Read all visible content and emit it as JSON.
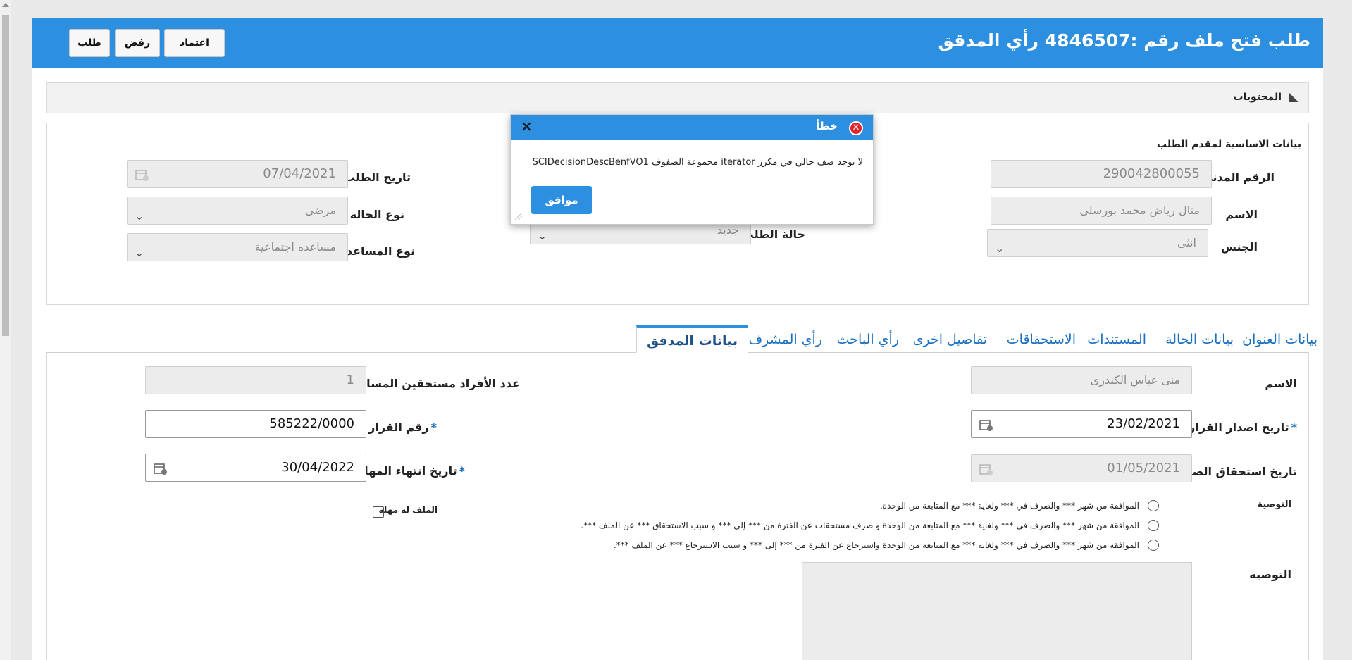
{
  "header": {
    "title": "طلب فتح ملف رقم :4846507 رأي المدقق",
    "buttons": {
      "approve": "اعتماد",
      "reject": "رفض",
      "request": "طلب"
    }
  },
  "contents_section": {
    "label": "المحتويات"
  },
  "applicant": {
    "title": "بيانات الاساسية لمقدم الطلب",
    "civil_id": {
      "label": "الرقم المدني",
      "value": "290042800055"
    },
    "name": {
      "label": "الاسم",
      "value": "منال رياض محمد بورسلى"
    },
    "gender": {
      "label": "الجنس",
      "value": "انثى"
    },
    "request_status": {
      "label": "حالة الطلب",
      "value": "جديد"
    },
    "request_date": {
      "label": "تاريخ الطلب",
      "value": "07/04/2021"
    },
    "case_type": {
      "label": "نوع الحالة",
      "value": "مرضى"
    },
    "aid_type": {
      "label": "نوع المساعدة",
      "value": "مساعده اجتماعية"
    }
  },
  "tabs": [
    {
      "label": "بيانات العنوان"
    },
    {
      "label": "بيانات الحالة"
    },
    {
      "label": "المستندات"
    },
    {
      "label": "الاستحقاقات"
    },
    {
      "label": "تفاصيل اخرى"
    },
    {
      "label": "رأي الباحث"
    },
    {
      "label": "رأي المشرف"
    },
    {
      "label": "بيانات المدقق"
    }
  ],
  "auditor": {
    "name": {
      "label": "الاسم",
      "value": "منى عباس الكندرى"
    },
    "eligible_count": {
      "label": "عدد الأفراد مستحقين المساعدة",
      "value": "1"
    },
    "decision_date": {
      "label": "تاريخ اصدار القرار",
      "value": "23/02/2021",
      "required": "*"
    },
    "decision_number": {
      "label": "رقم القرار",
      "value": "585222/0000",
      "required": "*"
    },
    "disbursement_date": {
      "label": "تاريخ استحقاق الصرف",
      "value": "01/05/2021"
    },
    "deadline_date": {
      "label": "تاريخ انتهاء المهلة",
      "value": "30/04/2022",
      "required": "*"
    },
    "recommendation_label": "التوصية",
    "recommendation_options": [
      "الموافقة من شهر *** والصرف في *** ولغاية *** مع المتابعة من الوحدة.",
      "الموافقة من شهر *** والصرف في *** ولغاية *** مع المتابعة من الوحدة و صرف مستحقات عن الفترة من *** إلى *** و سبب الاستحقاق *** عن الملف ***.",
      "الموافقة من شهر *** والصرف في *** ولغاية *** مع المتابعة من الوحدة واسترجاع عن الفترة من *** إلى *** و سبب الاسترجاع *** عن الملف ***."
    ],
    "has_deadline_label": "الملف له مهلة",
    "recommendation_text_label": "التوصية"
  },
  "dialog": {
    "title": "خطأ",
    "message": "لا يوجد صف حالي في مكرر iterator مجموعة الصفوف SCIDecisionDescBenfVO1",
    "ok": "موافق"
  },
  "colors": {
    "accent": "#2c8fdf",
    "error": "#e4222c",
    "link": "#1a6fc0"
  }
}
